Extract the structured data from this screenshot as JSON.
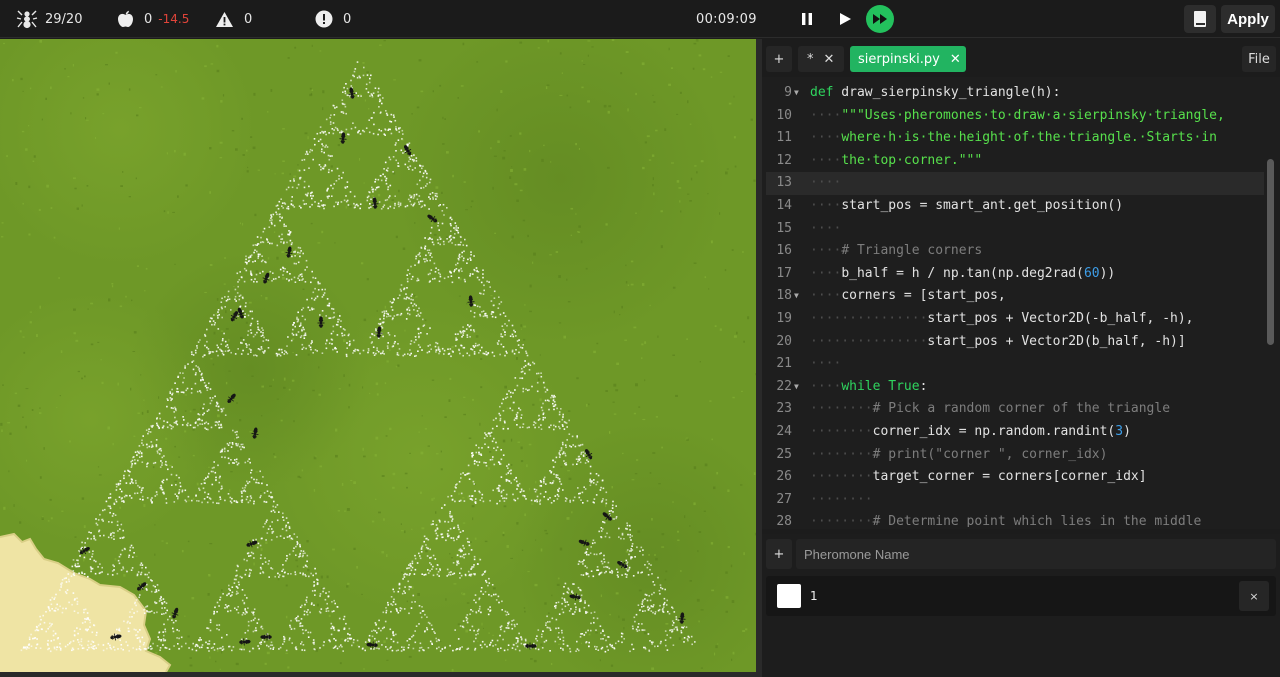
{
  "topbar": {
    "ants": "29/20",
    "food_count": "0",
    "food_delta": "-14.5",
    "warnings": "0",
    "errors": "0",
    "timer": "00:09:09",
    "apply_label": "Apply",
    "icons": [
      "ant-icon",
      "apple-icon",
      "warning-icon",
      "error-icon",
      "pause-icon",
      "play-icon",
      "fast-forward-icon",
      "book-icon"
    ]
  },
  "colors": {
    "accent": "#22b461",
    "grass": "#6f9a26",
    "sand": "#efe5a8",
    "pheromone": "#ffffff",
    "negative": "#e0443a"
  },
  "editor": {
    "tabs": [
      {
        "label": "+"
      },
      {
        "label": "*"
      },
      {
        "label": "sierpinski.py"
      }
    ],
    "file_label": "File",
    "lines": [
      {
        "n": "9",
        "fold": true,
        "html": "<span class='kw'>def</span> draw_sierpinsky_triangle(h):"
      },
      {
        "n": "10",
        "fold": false,
        "html": "<span class='ws'>····</span><span class='str'>\"\"\"Uses·pheromones·to·draw·a·sierpinsky·triangle,</span>"
      },
      {
        "n": "11",
        "fold": false,
        "html": "<span class='ws'>····</span><span class='str'>where·h·is·the·height·of·the·triangle.·Starts·in</span>"
      },
      {
        "n": "12",
        "fold": false,
        "html": "<span class='ws'>····</span><span class='str'>the·top·corner.\"\"\"</span>"
      },
      {
        "n": "13",
        "fold": false,
        "active": true,
        "html": "<span class='ws'>····</span>"
      },
      {
        "n": "14",
        "fold": false,
        "html": "<span class='ws'>····</span>start_pos = smart_ant.get_position()"
      },
      {
        "n": "15",
        "fold": false,
        "html": "<span class='ws'>····</span>"
      },
      {
        "n": "16",
        "fold": false,
        "html": "<span class='ws'>····</span><span class='cm'># Triangle corners</span>"
      },
      {
        "n": "17",
        "fold": false,
        "html": "<span class='ws'>····</span>b_half = h / np.tan(np.deg2rad(<span class='num'>60</span>))"
      },
      {
        "n": "18",
        "fold": true,
        "html": "<span class='ws'>····</span>corners = [start_pos,"
      },
      {
        "n": "19",
        "fold": false,
        "html": "<span class='ws'>···············</span>start_pos + Vector2D(-b_half, -h),"
      },
      {
        "n": "20",
        "fold": false,
        "html": "<span class='ws'>···············</span>start_pos + Vector2D(b_half, -h)]"
      },
      {
        "n": "21",
        "fold": false,
        "html": "<span class='ws'>····</span>"
      },
      {
        "n": "22",
        "fold": true,
        "html": "<span class='ws'>····</span><span class='kw'>while</span> <span class='kw'>True</span>:"
      },
      {
        "n": "23",
        "fold": false,
        "html": "<span class='ws'>········</span><span class='cm'># Pick a random corner of the triangle</span>"
      },
      {
        "n": "24",
        "fold": false,
        "html": "<span class='ws'>········</span>corner_idx = np.random.randint(<span class='num'>3</span>)"
      },
      {
        "n": "25",
        "fold": false,
        "html": "<span class='ws'>········</span><span class='cm'># print(\"corner \", corner_idx)</span>"
      },
      {
        "n": "26",
        "fold": false,
        "html": "<span class='ws'>········</span>target_corner = corners[corner_idx]"
      },
      {
        "n": "27",
        "fold": false,
        "html": "<span class='ws'>········</span>"
      },
      {
        "n": "28",
        "fold": false,
        "html": "<span class='ws'>········</span><span class='cm'># Determine point which lies in the middle</span>"
      }
    ]
  },
  "pheromones": {
    "add_label": "+",
    "name_placeholder": "Pheromone Name",
    "items": [
      {
        "label": "1",
        "delete_label": "×"
      }
    ]
  }
}
